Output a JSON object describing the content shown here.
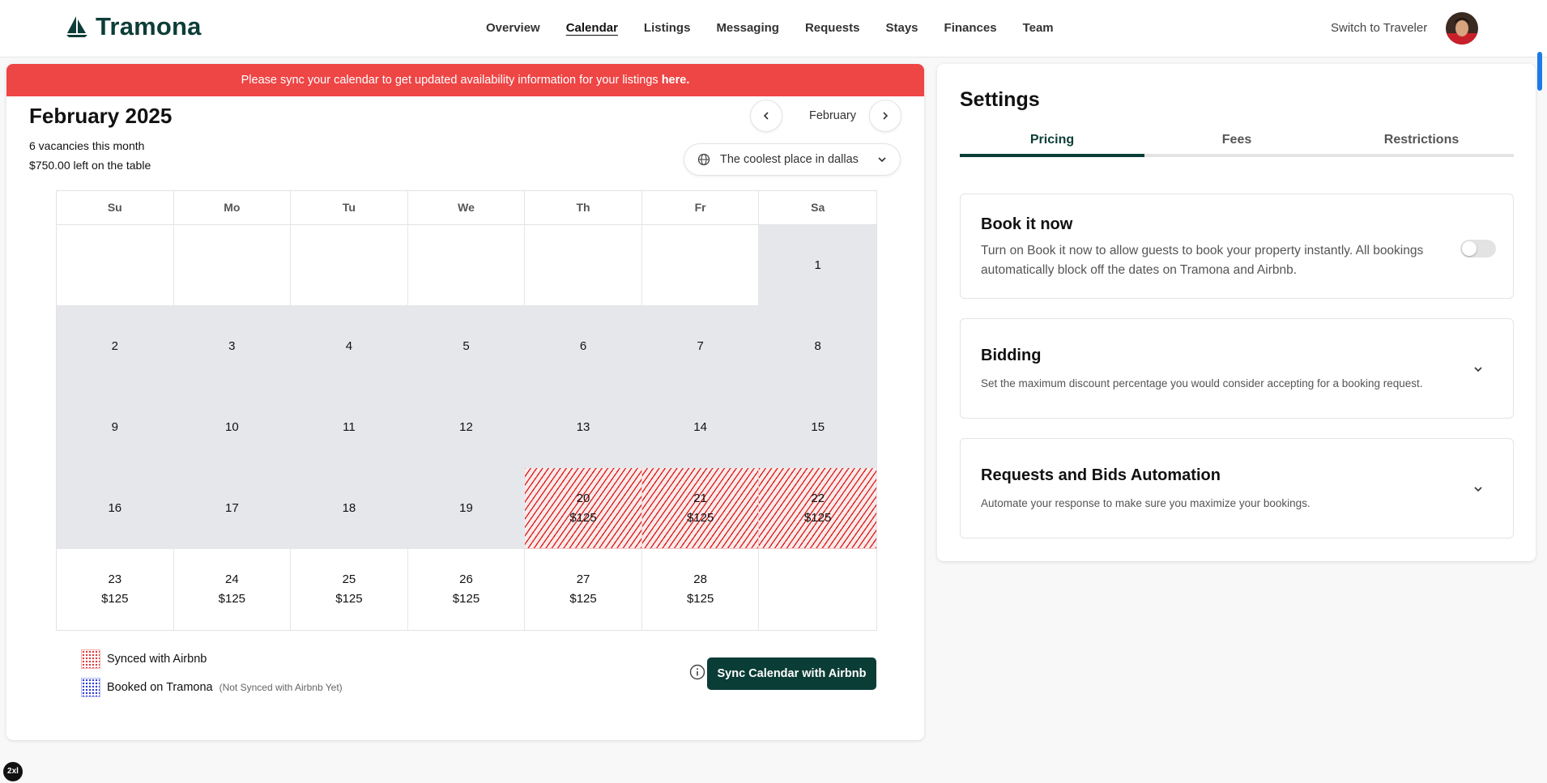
{
  "header": {
    "logo_text": "Tramona",
    "nav": [
      "Overview",
      "Calendar",
      "Listings",
      "Messaging",
      "Requests",
      "Stays",
      "Finances",
      "Team"
    ],
    "active_nav": "Calendar",
    "switch_label": "Switch to Traveler"
  },
  "alert": {
    "text": "Please sync your calendar to get updated availability information for your listings",
    "link": "here."
  },
  "calendar": {
    "title": "February 2025",
    "vacancies": "6 vacancies this month",
    "left_on_table": "$750.00 left on the table",
    "month_label": "February",
    "listing": "The coolest place in dallas",
    "weekdays": [
      "Su",
      "Mo",
      "Tu",
      "We",
      "Th",
      "Fr",
      "Sa"
    ],
    "days": [
      {
        "day": "",
        "price": "",
        "state": "empty"
      },
      {
        "day": "",
        "price": "",
        "state": "empty"
      },
      {
        "day": "",
        "price": "",
        "state": "empty"
      },
      {
        "day": "",
        "price": "",
        "state": "empty"
      },
      {
        "day": "",
        "price": "",
        "state": "empty"
      },
      {
        "day": "",
        "price": "",
        "state": "empty"
      },
      {
        "day": "1",
        "price": "",
        "state": "blocked"
      },
      {
        "day": "2",
        "price": "",
        "state": "blocked"
      },
      {
        "day": "3",
        "price": "",
        "state": "blocked"
      },
      {
        "day": "4",
        "price": "",
        "state": "blocked"
      },
      {
        "day": "5",
        "price": "",
        "state": "blocked"
      },
      {
        "day": "6",
        "price": "",
        "state": "blocked"
      },
      {
        "day": "7",
        "price": "",
        "state": "blocked"
      },
      {
        "day": "8",
        "price": "",
        "state": "blocked"
      },
      {
        "day": "9",
        "price": "",
        "state": "blocked"
      },
      {
        "day": "10",
        "price": "",
        "state": "blocked"
      },
      {
        "day": "11",
        "price": "",
        "state": "blocked"
      },
      {
        "day": "12",
        "price": "",
        "state": "blocked"
      },
      {
        "day": "13",
        "price": "",
        "state": "blocked"
      },
      {
        "day": "14",
        "price": "",
        "state": "blocked"
      },
      {
        "day": "15",
        "price": "",
        "state": "blocked"
      },
      {
        "day": "16",
        "price": "",
        "state": "blocked"
      },
      {
        "day": "17",
        "price": "",
        "state": "blocked"
      },
      {
        "day": "18",
        "price": "",
        "state": "blocked"
      },
      {
        "day": "19",
        "price": "",
        "state": "blocked"
      },
      {
        "day": "20",
        "price": "$125",
        "state": "synced"
      },
      {
        "day": "21",
        "price": "$125",
        "state": "synced"
      },
      {
        "day": "22",
        "price": "$125",
        "state": "synced"
      },
      {
        "day": "23",
        "price": "$125",
        "state": "available"
      },
      {
        "day": "24",
        "price": "$125",
        "state": "available"
      },
      {
        "day": "25",
        "price": "$125",
        "state": "available"
      },
      {
        "day": "26",
        "price": "$125",
        "state": "available"
      },
      {
        "day": "27",
        "price": "$125",
        "state": "available"
      },
      {
        "day": "28",
        "price": "$125",
        "state": "available"
      },
      {
        "day": "",
        "price": "",
        "state": "empty"
      }
    ],
    "legend": {
      "synced": "Synced with Airbnb",
      "booked": "Booked on Tramona",
      "booked_note": "(Not Synced with Airbnb Yet)"
    },
    "sync_button": "Sync Calendar with Airbnb",
    "colors": {
      "synced": "#d91a1a",
      "booked": "#2d3ad6",
      "blocked": "#e6e7eb",
      "primary": "#0b3d37",
      "alert": "#ee4545"
    }
  },
  "settings": {
    "title": "Settings",
    "tabs": [
      "Pricing",
      "Fees",
      "Restrictions"
    ],
    "active_tab": "Pricing",
    "book_now": {
      "title": "Book it now",
      "desc": "Turn on Book it now to allow guests to book your property instantly. All bookings automatically block off the dates on Tramona and Airbnb.",
      "enabled": false
    },
    "bidding": {
      "title": "Bidding",
      "desc": "Set the maximum discount percentage you would consider accepting for a booking request."
    },
    "automation": {
      "title": "Requests and Bids Automation",
      "desc": "Automate your response to make sure you maximize your bookings."
    }
  },
  "badge": "2xl"
}
